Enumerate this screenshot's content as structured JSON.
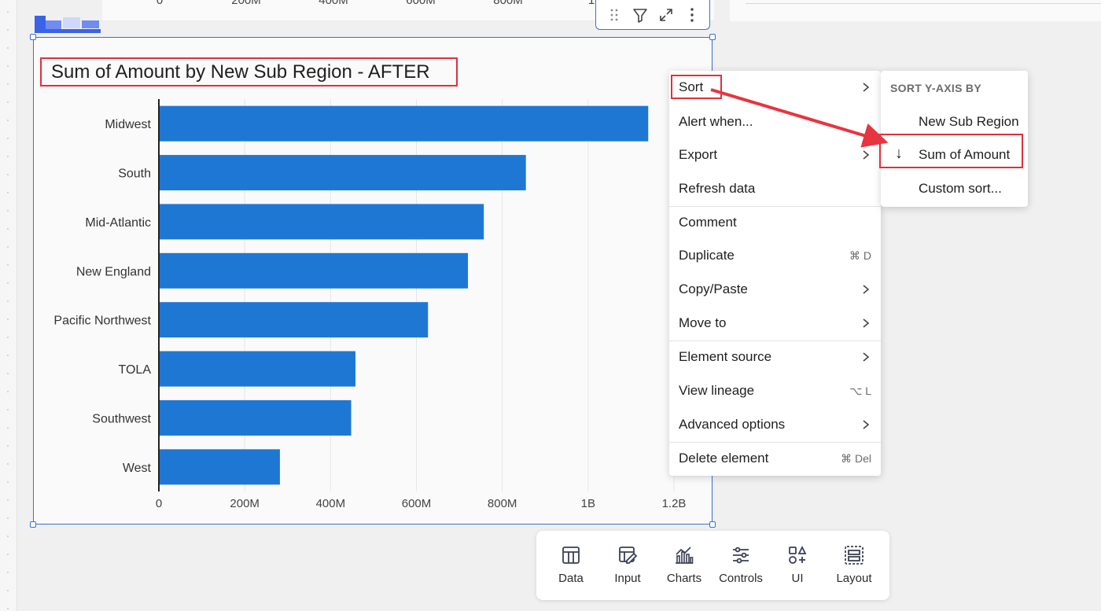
{
  "previous_chart": {
    "x_ticks": [
      "0",
      "200M",
      "400M",
      "600M",
      "800M",
      "1"
    ]
  },
  "toolbar": {
    "drag_icon": "drag-handle-icon",
    "filter_icon": "filter-icon",
    "expand_icon": "expand-icon",
    "more_icon": "more-vertical-icon"
  },
  "chart_data": {
    "type": "bar",
    "orientation": "horizontal",
    "title": "Sum of Amount by New Sub Region - AFTER",
    "categories": [
      "Midwest",
      "South",
      "Mid-Atlantic",
      "New England",
      "Pacific Northwest",
      "TOLA",
      "Southwest",
      "West"
    ],
    "values": [
      1140000000,
      855000000,
      757000000,
      720000000,
      627000000,
      458000000,
      448000000,
      282000000
    ],
    "x_ticks": [
      {
        "value": 0,
        "label": "0"
      },
      {
        "value": 200000000,
        "label": "200M"
      },
      {
        "value": 400000000,
        "label": "400M"
      },
      {
        "value": 600000000,
        "label": "600M"
      },
      {
        "value": 800000000,
        "label": "800M"
      },
      {
        "value": 1000000000,
        "label": "1B"
      },
      {
        "value": 1200000000,
        "label": "1.2B"
      }
    ],
    "xlim": [
      0,
      1200000000
    ],
    "grid": true,
    "bar_color": "#1f77d4"
  },
  "context_menu": {
    "items": [
      {
        "label": "Sort",
        "submenu": true,
        "shortcut": ""
      },
      {
        "label": "Alert when...",
        "submenu": false,
        "shortcut": ""
      },
      {
        "label": "Export",
        "submenu": true,
        "shortcut": ""
      },
      {
        "label": "Refresh data",
        "submenu": false,
        "shortcut": ""
      },
      {
        "label": "Comment",
        "submenu": false,
        "shortcut": ""
      },
      {
        "label": "Duplicate",
        "submenu": false,
        "shortcut": "⌘ D"
      },
      {
        "label": "Copy/Paste",
        "submenu": true,
        "shortcut": ""
      },
      {
        "label": "Move to",
        "submenu": true,
        "shortcut": ""
      },
      {
        "label": "Element source",
        "submenu": true,
        "shortcut": ""
      },
      {
        "label": "View lineage",
        "submenu": false,
        "shortcut": "⌥ L"
      },
      {
        "label": "Advanced options",
        "submenu": true,
        "shortcut": ""
      },
      {
        "label": "Delete element",
        "submenu": false,
        "shortcut": "⌘ Del"
      }
    ]
  },
  "sort_submenu": {
    "header": "SORT Y-AXIS BY",
    "items": [
      {
        "label": "New Sub Region",
        "active": false,
        "indicator": ""
      },
      {
        "label": "Sum of Amount",
        "active": true,
        "indicator": "↓"
      },
      {
        "label": "Custom sort...",
        "active": false,
        "indicator": ""
      }
    ]
  },
  "bottom_bar": {
    "items": [
      {
        "label": "Data",
        "icon": "table-icon"
      },
      {
        "label": "Input",
        "icon": "input-table-icon"
      },
      {
        "label": "Charts",
        "icon": "charts-icon"
      },
      {
        "label": "Controls",
        "icon": "sliders-icon"
      },
      {
        "label": "UI",
        "icon": "shapes-icon"
      },
      {
        "label": "Layout",
        "icon": "layout-icon"
      }
    ]
  },
  "colors": {
    "accent": "#3b6fd8",
    "highlight": "#e0303c",
    "bar": "#1f77d4"
  }
}
